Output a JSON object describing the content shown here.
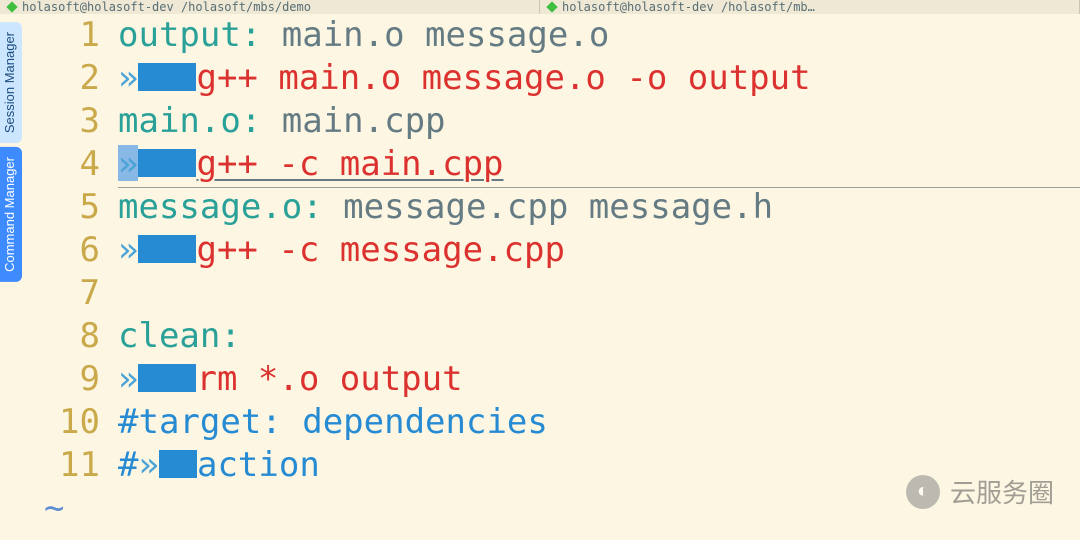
{
  "tabs": [
    {
      "label": "holasoft@holasoft-dev  /holasoft/mbs/demo"
    },
    {
      "label": "holasoft@holasoft-dev  /holasoft/mb…"
    }
  ],
  "side_tabs": {
    "session": "Session Manager",
    "command": "Command Manager"
  },
  "gutter": [
    "1",
    "2",
    "3",
    "4",
    "5",
    "6",
    "7",
    "8",
    "9",
    "10",
    "11"
  ],
  "lines": {
    "l1_target": "output:",
    "l1_deps": " main.o message.o",
    "l2_cmd": "g++ main.o message.o -o output",
    "l3_target": "main.o:",
    "l3_deps": " main.cpp",
    "l4_cmd": "g++ -c main.cpp",
    "l5_target": "message.o:",
    "l5_deps": " message.cpp message.h",
    "l6_cmd": "g++ -c message.cpp",
    "l8_target": "clean:",
    "l9_cmd": "rm *.o output",
    "l10_cmt": "#target: dependencies",
    "l11_cmt_a": "#",
    "l11_cmt_b": "action"
  },
  "chevron": "»",
  "tilde": "~",
  "watermark": {
    "icon": "◐",
    "text": "云服务圈"
  }
}
